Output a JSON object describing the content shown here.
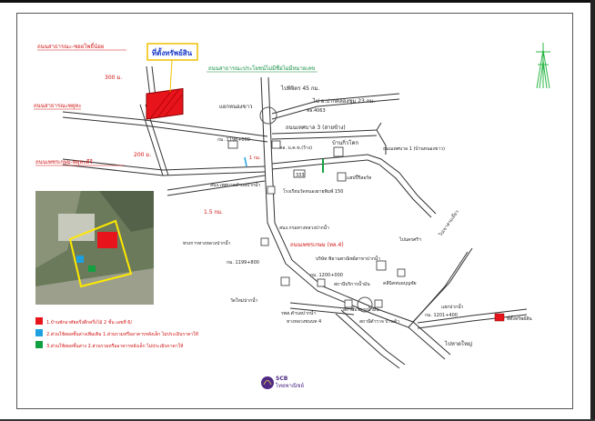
{
  "map": {
    "property_title": "ที่ตั้งทรัพย์สิน",
    "roads": {
      "soi_phonoi": "ถนนสาธารณะ-ซอยโพธิ์น้อย",
      "soi_phunya": "ถนนสาธารณะพยุหะ",
      "public_road": "ถนนสาธารณะประโยชน์ไม่มีชื่อไม่มีหมายเลข",
      "phetkasem_phunya": "ถนนเพชรเกษม-พยุหะคีรี",
      "dist_300": "300 ม.",
      "dist_200": "200 ม.",
      "dist_15": "1.5 กม.",
      "dist_1": "1 กม.",
      "to_north_45": "ไปพิจิตร 45 กม.",
      "to_pakkhlong": "ไป อ.ปากคลองชุม 23 กม.",
      "rd_4063": "ทล.4063",
      "junction_nongkhao": "แยกหนองขาว",
      "local_road_3": "ถนนเทศบาล 3 (สายข้าง)",
      "km_1198": "กม. 1198+000",
      "dept_highway": "ทล. บ.ค.ข.(ร้าง)",
      "ban_kokmai": "บ้านกิ่วโคก",
      "local_road_1": "ถนนเทศบาล 1 (บ้านหนองขาว)",
      "number_333": "333",
      "gas_station": "แฮปปี้รีสอร์ท",
      "subdistrict_office": "สนง.เทศบาลตำบลปากน้ำ",
      "school": "โรงเรียนวัดหนองยายพิมพ์ 150",
      "agri_office": "สนง.กรมทางหลวงปากน้ำ",
      "police": "ทรงการทางหลวงปากน้ำ",
      "phetkasem_main": "ถนนเพชรเกษม (ทล.4)",
      "km_1199": "กม. 1199+800",
      "company": "บริษัท พิธานพาณิชย์สาขาปากน้ำ",
      "km_1200": "กม. 1200+000",
      "gas_esso": "สถานีบริการน้ำมัน",
      "clinic": "คลีนิคหมอบุญชัย",
      "temple": "วัดใหม่ปากน้ำ",
      "tambon_office": "รพส.ตำบลปากน้ำ",
      "municipal_office": "ทางหลวงชนบท 4",
      "police_station": "สถานีตำรวจ บ้านค้า",
      "junction_2": "แยกปากน้ำ",
      "km_1201": "กม. 1201+400",
      "to_south": "ไปเขาสามเดี่ยว",
      "to_nakhon": "ไปหาดใหญ่",
      "to_pilok": "ไปนครศรีฯ",
      "legend_property": "ที่ตั้งทรัพย์สิน"
    },
    "legend": [
      {
        "color": "#e8141c",
        "text": "1.บ้านพักอาศัยครึ่งตึกครึ่งไม้ 2 ชั้น เลขที่ 6/"
      },
      {
        "color": "#1ea0e0",
        "text": "2.ส่วนใช้สอยชั้นล่างเพิ่มเติม 1.ส่วนรวมหรืออาคารหลังเล็ก ไม่ประเมินราคาให้"
      },
      {
        "color": "#12a040",
        "text": "3.ส่วนใช้สอยชั้นล่าง 2.ส่วนรวมหรืออาคารหลังเล็ก ไม่ประเมินราคาให้"
      }
    ],
    "bank": {
      "logo_text": "SCB",
      "name": "ไทยพาณิชย์"
    },
    "colors": {
      "property": "#e8141c",
      "road_label_red": "#d01010",
      "road_label_green": "#109040",
      "north_arrow": "#2eb84a"
    }
  }
}
